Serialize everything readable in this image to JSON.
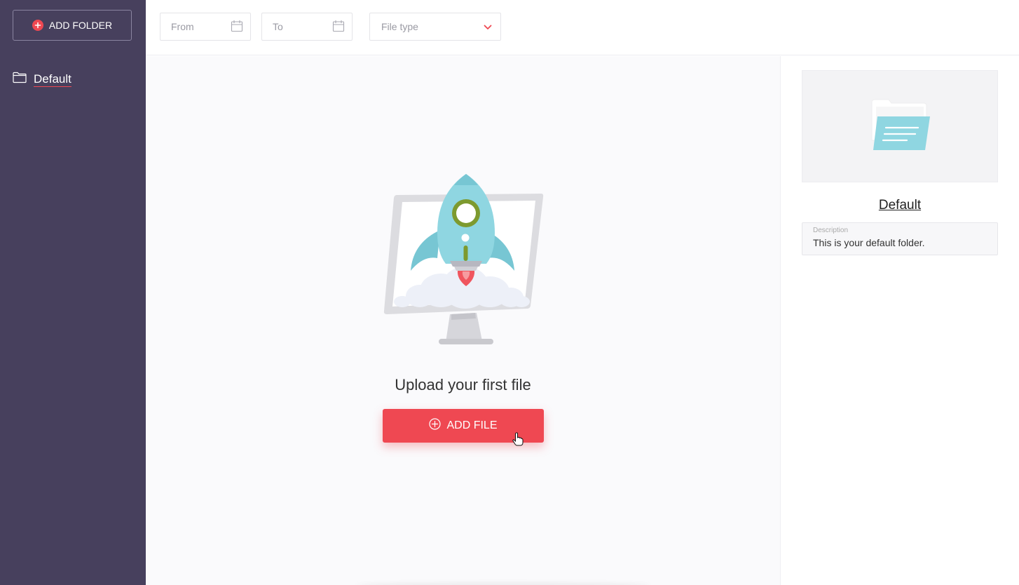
{
  "sidebar": {
    "add_folder_label": "ADD FOLDER",
    "folders": [
      {
        "label": "Default"
      }
    ]
  },
  "filters": {
    "from_placeholder": "From",
    "to_placeholder": "To",
    "file_type_placeholder": "File type"
  },
  "main": {
    "empty_title": "Upload your first file",
    "add_file_label": "ADD FILE"
  },
  "details": {
    "title": "Default",
    "description_label": "Description",
    "description_text": "This is your default folder."
  },
  "icons": {
    "add_folder": "plus-circle-icon",
    "folder": "folder-icon",
    "calendar": "calendar-icon",
    "dropdown": "chevron-down-icon",
    "add_file": "plus-circle-outline-icon"
  },
  "colors": {
    "sidebar_bg": "#47405d",
    "accent": "#ef4852",
    "main_bg": "#fafafc"
  }
}
